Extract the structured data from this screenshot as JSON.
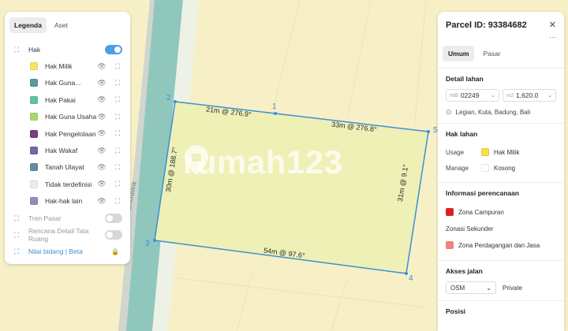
{
  "map": {
    "road_name": "Jalan Pandawa",
    "watermark": "rumah123",
    "edges": [
      {
        "label": "21m @ 276.9°"
      },
      {
        "label": "33m @ 276.8°"
      },
      {
        "label": "31m @ 9.1°"
      },
      {
        "label": "54m @ 97.6°"
      },
      {
        "label": "30m @ 188.7°"
      }
    ],
    "vertices": [
      "1",
      "2",
      "3",
      "4",
      "5"
    ],
    "colors": {
      "boundary": "#3b8fd6",
      "parcel_fill": "#eef0b5",
      "road": "#8fc7bd"
    }
  },
  "left_panel": {
    "tabs": [
      {
        "label": "Legenda",
        "active": true
      },
      {
        "label": "Aset",
        "active": false
      }
    ],
    "hak": {
      "label": "Hak",
      "enabled": true
    },
    "legend": [
      {
        "label": "Hak Milik",
        "color": "#f7e463"
      },
      {
        "label": "Hak Guna...",
        "color": "#5b9aa0"
      },
      {
        "label": "Hak Pakai",
        "color": "#5ec3a3"
      },
      {
        "label": "Hak Guna Usaha",
        "color": "#a6d96a"
      },
      {
        "label": "Hak Pengelolaan",
        "color": "#7b3f7a"
      },
      {
        "label": "Hak Wakaf",
        "color": "#6f6aa5"
      },
      {
        "label": "Tanah Ulayat",
        "color": "#5f8fa0"
      },
      {
        "label": "Tidak terdefinisi",
        "color": "#ececec"
      },
      {
        "label": "Hak-hak lain",
        "color": "#9a88b5"
      }
    ],
    "tren_pasar": {
      "label": "Tren Pasar",
      "enabled": false
    },
    "rdtr": {
      "label": "Rencana Detail Tata Ruang",
      "enabled": false
    },
    "nilai_bidang": {
      "label": "Nilai bidang | Beta"
    }
  },
  "right_panel": {
    "title": "Parcel ID: 93384682",
    "more": "···",
    "tabs": [
      {
        "label": "Umum",
        "active": true
      },
      {
        "label": "Pasar",
        "active": false
      }
    ],
    "detail": {
      "title": "Detail lahan",
      "nib_prefix": "NIB",
      "nib": "02249",
      "area_prefix": "m2",
      "area": "1,620.0",
      "location": "Legian, Kuta, Badung, Bali"
    },
    "hak_lahan": {
      "title": "Hak lahan",
      "usage_key": "Usage",
      "usage_value": "Hak Milik",
      "usage_color": "#f7e04a",
      "manage_key": "Manage",
      "manage_value": "Kosong",
      "manage_color": "#ffffff"
    },
    "perencanaan": {
      "title": "Informasi perencanaan",
      "zona": "Zona Campuran",
      "zona_color": "#e02020",
      "sekunder_title": "Zonasi Sekunder",
      "zona_sekunder": "Zona Perdagangan dan Jasa",
      "zona_sekunder_color": "#f08080"
    },
    "akses": {
      "title": "Akses jalan",
      "source": "OSM",
      "value": "Private"
    },
    "posisi": {
      "title": "Posisi"
    }
  }
}
